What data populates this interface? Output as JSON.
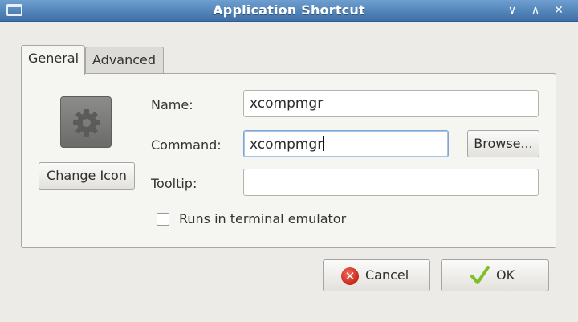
{
  "window": {
    "title": "Application Shortcut",
    "controls": {
      "minimize": "∨",
      "maximize": "∧",
      "close": "✕"
    }
  },
  "tabs": [
    {
      "label": "General",
      "active": true
    },
    {
      "label": "Advanced",
      "active": false
    }
  ],
  "icon": {
    "name": "gear-icon",
    "change_label": "Change Icon"
  },
  "form": {
    "name_label": "Name:",
    "name_value": "xcompmgr",
    "command_label": "Command:",
    "command_value": "xcompmgr",
    "browse_label": "Browse...",
    "tooltip_label": "Tooltip:",
    "tooltip_value": "",
    "terminal_label": "Runs in terminal emulator",
    "terminal_checked": false
  },
  "actions": {
    "cancel_label": "Cancel",
    "ok_label": "OK"
  },
  "colors": {
    "titlebar": "#4a7cb4",
    "cancel_icon": "#d4392b",
    "ok_check": "#7fbf2a"
  }
}
